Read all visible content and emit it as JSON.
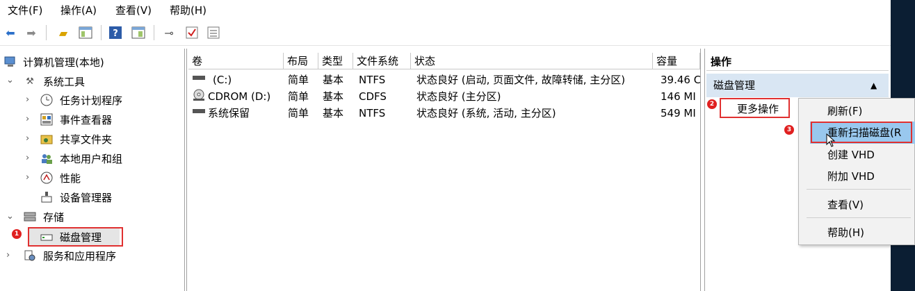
{
  "menubar": {
    "file": "文件(F)",
    "action": "操作(A)",
    "view": "查看(V)",
    "help": "帮助(H)"
  },
  "toolbar": {
    "icons": [
      "back-icon",
      "forward-icon",
      "up-folder-icon",
      "show-hide-tree-icon",
      "help-icon",
      "properties-icon",
      "connect-icon",
      "checkmark-icon",
      "list-icon"
    ]
  },
  "tree": {
    "root": "计算机管理(本地)",
    "system_tools": "系统工具",
    "task_scheduler": "任务计划程序",
    "event_viewer": "事件查看器",
    "shared_folders": "共享文件夹",
    "local_users": "本地用户和组",
    "performance": "性能",
    "device_manager": "设备管理器",
    "storage": "存储",
    "disk_management": "磁盘管理",
    "services_apps": "服务和应用程序"
  },
  "table": {
    "headers": [
      "卷",
      "布局",
      "类型",
      "文件系统",
      "状态",
      "容量"
    ],
    "rows": [
      {
        "volume": "(C:)",
        "layout": "简单",
        "type": "基本",
        "fs": "NTFS",
        "status": "状态良好 (启动, 页面文件, 故障转储, 主分区)",
        "capacity": "39.46 C"
      },
      {
        "volume": "CDROM (D:)",
        "layout": "简单",
        "type": "基本",
        "fs": "CDFS",
        "status": "状态良好 (主分区)",
        "capacity": "146 MI"
      },
      {
        "volume": "系统保留",
        "layout": "简单",
        "type": "基本",
        "fs": "NTFS",
        "status": "状态良好 (系统, 活动, 主分区)",
        "capacity": "549 MI"
      }
    ]
  },
  "actions": {
    "header": "操作",
    "section": "磁盘管理",
    "more": "更多操作"
  },
  "context_menu": {
    "refresh": "刷新(F)",
    "rescan": "重新扫描磁盘(R",
    "create_vhd": "创建 VHD",
    "attach_vhd": "附加 VHD",
    "view": "查看(V)",
    "help": "帮助(H)"
  },
  "callouts": [
    "1",
    "2",
    "3"
  ],
  "colors": {
    "accent_highlight": "#99c8ee",
    "section_bg": "#d9e6f3",
    "callout_red": "#e03030",
    "desktop": "#0b1e33"
  }
}
